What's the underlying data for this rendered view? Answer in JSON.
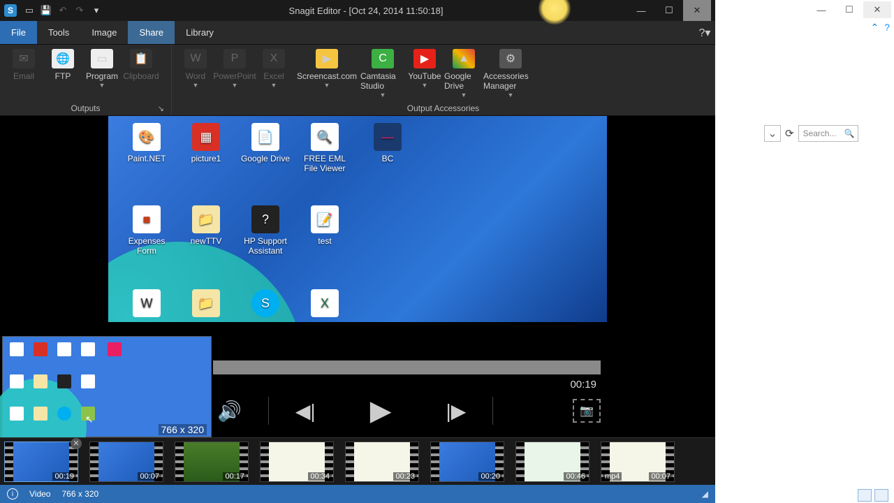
{
  "app_title": "Snagit Editor - [Oct 24, 2014 11:50:18]",
  "tabs": {
    "file": "File",
    "tools": "Tools",
    "image": "Image",
    "share": "Share",
    "library": "Library"
  },
  "ribbon": {
    "outputs_label": "Outputs",
    "accessories_label": "Output Accessories",
    "items": {
      "email": "Email",
      "ftp": "FTP",
      "program": "Program",
      "clipboard": "Clipboard",
      "word": "Word",
      "powerpoint": "PowerPoint",
      "excel": "Excel",
      "screencast": "Screencast.com",
      "camtasia": "Camtasia Studio",
      "youtube": "YouTube",
      "gdrive": "Google Drive",
      "acc_mgr": "Accessories Manager"
    }
  },
  "desktop_icons": {
    "paintnet": "Paint.NET",
    "picture1": "picture1",
    "gdrive": "Google Drive",
    "eml": "FREE EML File Viewer",
    "bc": "BC",
    "expenses": "Expenses Form",
    "newttv": "newTTV",
    "hp": "HP Support Assistant",
    "test": "test"
  },
  "thumb_dim": "766 x 320",
  "player": {
    "time": "00:19"
  },
  "tray": {
    "items": [
      {
        "dur": "00:19",
        "sel": true
      },
      {
        "dur": "00:07"
      },
      {
        "dur": "00:17"
      },
      {
        "dur": "00:34"
      },
      {
        "dur": "00:23"
      },
      {
        "dur": "00:20"
      },
      {
        "dur": "00:46"
      },
      {
        "dur": "00:07",
        "ext": "mp4"
      }
    ]
  },
  "status": {
    "type": "Video",
    "dim": "766 x 320"
  },
  "bg": {
    "search_placeholder": "Search..."
  },
  "chart_data": {
    "type": "table",
    "note": "no chart present"
  }
}
